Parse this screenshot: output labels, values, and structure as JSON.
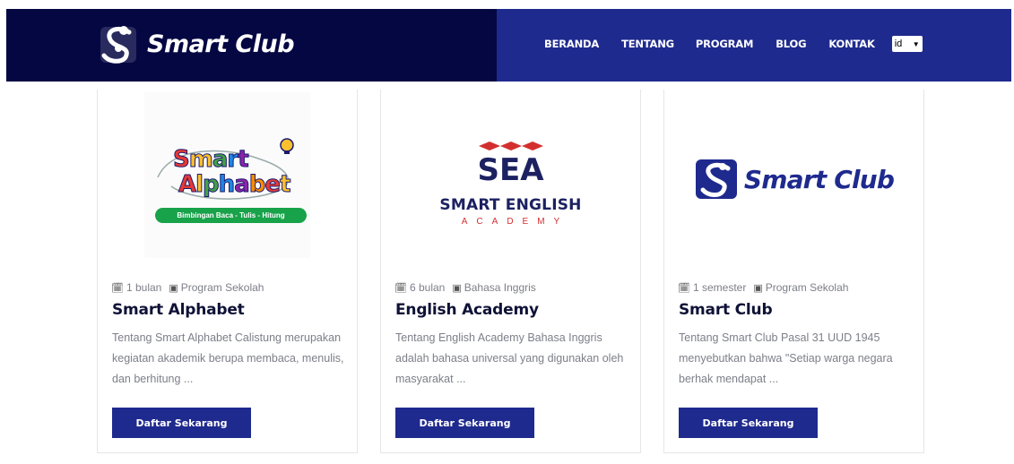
{
  "header": {
    "brand": "Smart Club",
    "nav": [
      "BERANDA",
      "TENTANG",
      "PROGRAM",
      "BLOG",
      "KONTAK"
    ],
    "language": "id"
  },
  "colors": {
    "header_dark": "#040742",
    "header_blue": "#1f2a8e",
    "button": "#1f2a8e"
  },
  "cards": [
    {
      "logo_words": [
        "Smart",
        "Alphabet"
      ],
      "logo_tagline": "Bimbingan Baca - Tulis - Hitung",
      "duration": "1 bulan",
      "category": "Program Sekolah",
      "title": "Smart Alphabet",
      "description": "Tentang Smart Alphabet Calistung merupakan kegiatan akademik berupa membaca, menulis, dan berhitung ...",
      "button": "Daftar Sekarang"
    },
    {
      "logo_letters": "SEA",
      "logo_name": "SMART ENGLISH",
      "logo_sub": "ACADEMY",
      "duration": "6 bulan",
      "category": "Bahasa Inggris",
      "title": "English Academy",
      "description": "Tentang English Academy Bahasa Inggris adalah bahasa universal yang digunakan oleh masyarakat ...",
      "button": "Daftar Sekarang"
    },
    {
      "logo_text": "Smart Club",
      "duration": "1 semester",
      "category": "Program Sekolah",
      "title": "Smart Club",
      "description": "Tentang Smart Club Pasal 31 UUD 1945 menyebutkan bahwa \"Setiap warga negara berhak mendapat ...",
      "button": "Daftar Sekarang"
    }
  ]
}
